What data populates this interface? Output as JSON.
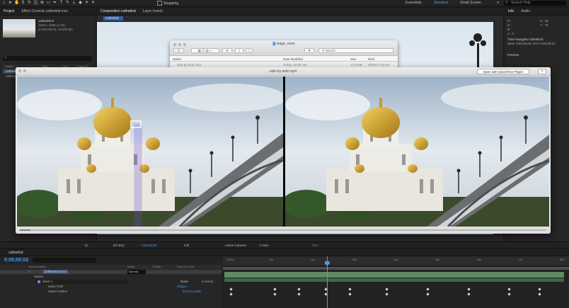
{
  "toolbar": {
    "snapping": "Snapping",
    "workspaces": [
      "Essentials",
      "Standard",
      "Small Screen"
    ],
    "active_workspace": "Standard",
    "search_placeholder": "Search Help"
  },
  "project_panel": {
    "tabs": [
      "Project",
      "Effect Controls cathedral.mov"
    ],
    "item_name": "cathedral ▾",
    "item_meta": [
      "1920 x 1080 (1.00)",
      "Δ 0;00;08;10, 23.976 fps"
    ],
    "columns": [
      "Name",
      "Type",
      "Size",
      "Frame R..."
    ],
    "rows": [
      {
        "name": "cathedral",
        "highlight": true
      },
      {
        "name": "cathedral.mov",
        "highlight": false
      }
    ]
  },
  "composition_panel": {
    "tabs": [
      "Composition cathedral",
      "Layer (none)"
    ],
    "comp_tab_label": "cathedral"
  },
  "info_panel": {
    "tabs": [
      "Info",
      "Audio"
    ],
    "lines": [
      "R :",
      "G :",
      "B :",
      "A : 0",
      "X : 40",
      "Y : 75"
    ],
    "nav_title": "Time Navigator Start/End",
    "nav_value": "Start: 0;00;00;00, End: 0;00;08;10",
    "preview_title": "Preview"
  },
  "viewer_bar": {
    "zoom": "(67.8%)",
    "timecode": "0;00;00;00",
    "resolution": "Full",
    "camera": "Active Camera",
    "views": "1 View",
    "exposure": "+0.0"
  },
  "finder": {
    "title": "stage_oven",
    "search_placeholder": "Search",
    "columns": [
      "Name",
      "Date Modified",
      "Size",
      "Kind"
    ],
    "row": [
      "side-by-side.mp4",
      "Today, 10:25 AM",
      "12.9 MB",
      "MPEG-4 movie"
    ]
  },
  "quicktime": {
    "title": "side-by-side.mp4",
    "open_button": "Open with QuickTime Player",
    "progress": 0.02
  },
  "timeline": {
    "tab": "cathedral",
    "timecode": "0;00;00;02",
    "layer_header": [
      "#",
      "Source Name",
      "Mode",
      "T",
      "TrkMat",
      "Parent & Link"
    ],
    "rows": [
      {
        "label": "1",
        "name": "[cathedral.mov]",
        "mode": "Normal"
      },
      {
        "label": "",
        "name": "Masks",
        "mode": ""
      },
      {
        "label": "",
        "name": "Mask 1",
        "mode": "None"
      },
      {
        "label": "",
        "name": "Mask Path",
        "mode": "Shape..."
      },
      {
        "label": "",
        "name": "Mask Feather",
        "mode": "0.0,0.0 pixels"
      }
    ],
    "inverted_label": "Inverted",
    "ruler_ticks": [
      "0;00s",
      "01s",
      "02s",
      "03s",
      "04s",
      "05s",
      "06s",
      "07s",
      "08s"
    ],
    "playhead_fraction": 0.3
  }
}
